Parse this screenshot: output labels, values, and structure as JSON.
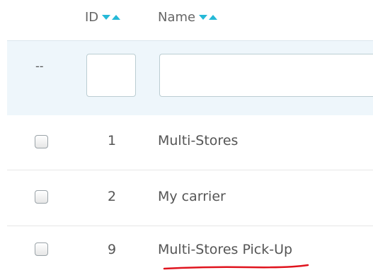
{
  "header": {
    "id_label": "ID",
    "name_label": "Name"
  },
  "filter": {
    "placeholder_symbol": "--",
    "id_value": "",
    "name_value": ""
  },
  "rows": [
    {
      "id": "1",
      "name": "Multi-Stores"
    },
    {
      "id": "2",
      "name": "My carrier"
    },
    {
      "id": "9",
      "name": "Multi-Stores Pick-Up"
    }
  ],
  "colors": {
    "accent": "#25b9d7",
    "filter_bg": "#eef6fb",
    "annotation_red": "#e0141e"
  },
  "icons": [
    "sort-descending-icon",
    "sort-ascending-icon",
    "checkbox-icon"
  ]
}
